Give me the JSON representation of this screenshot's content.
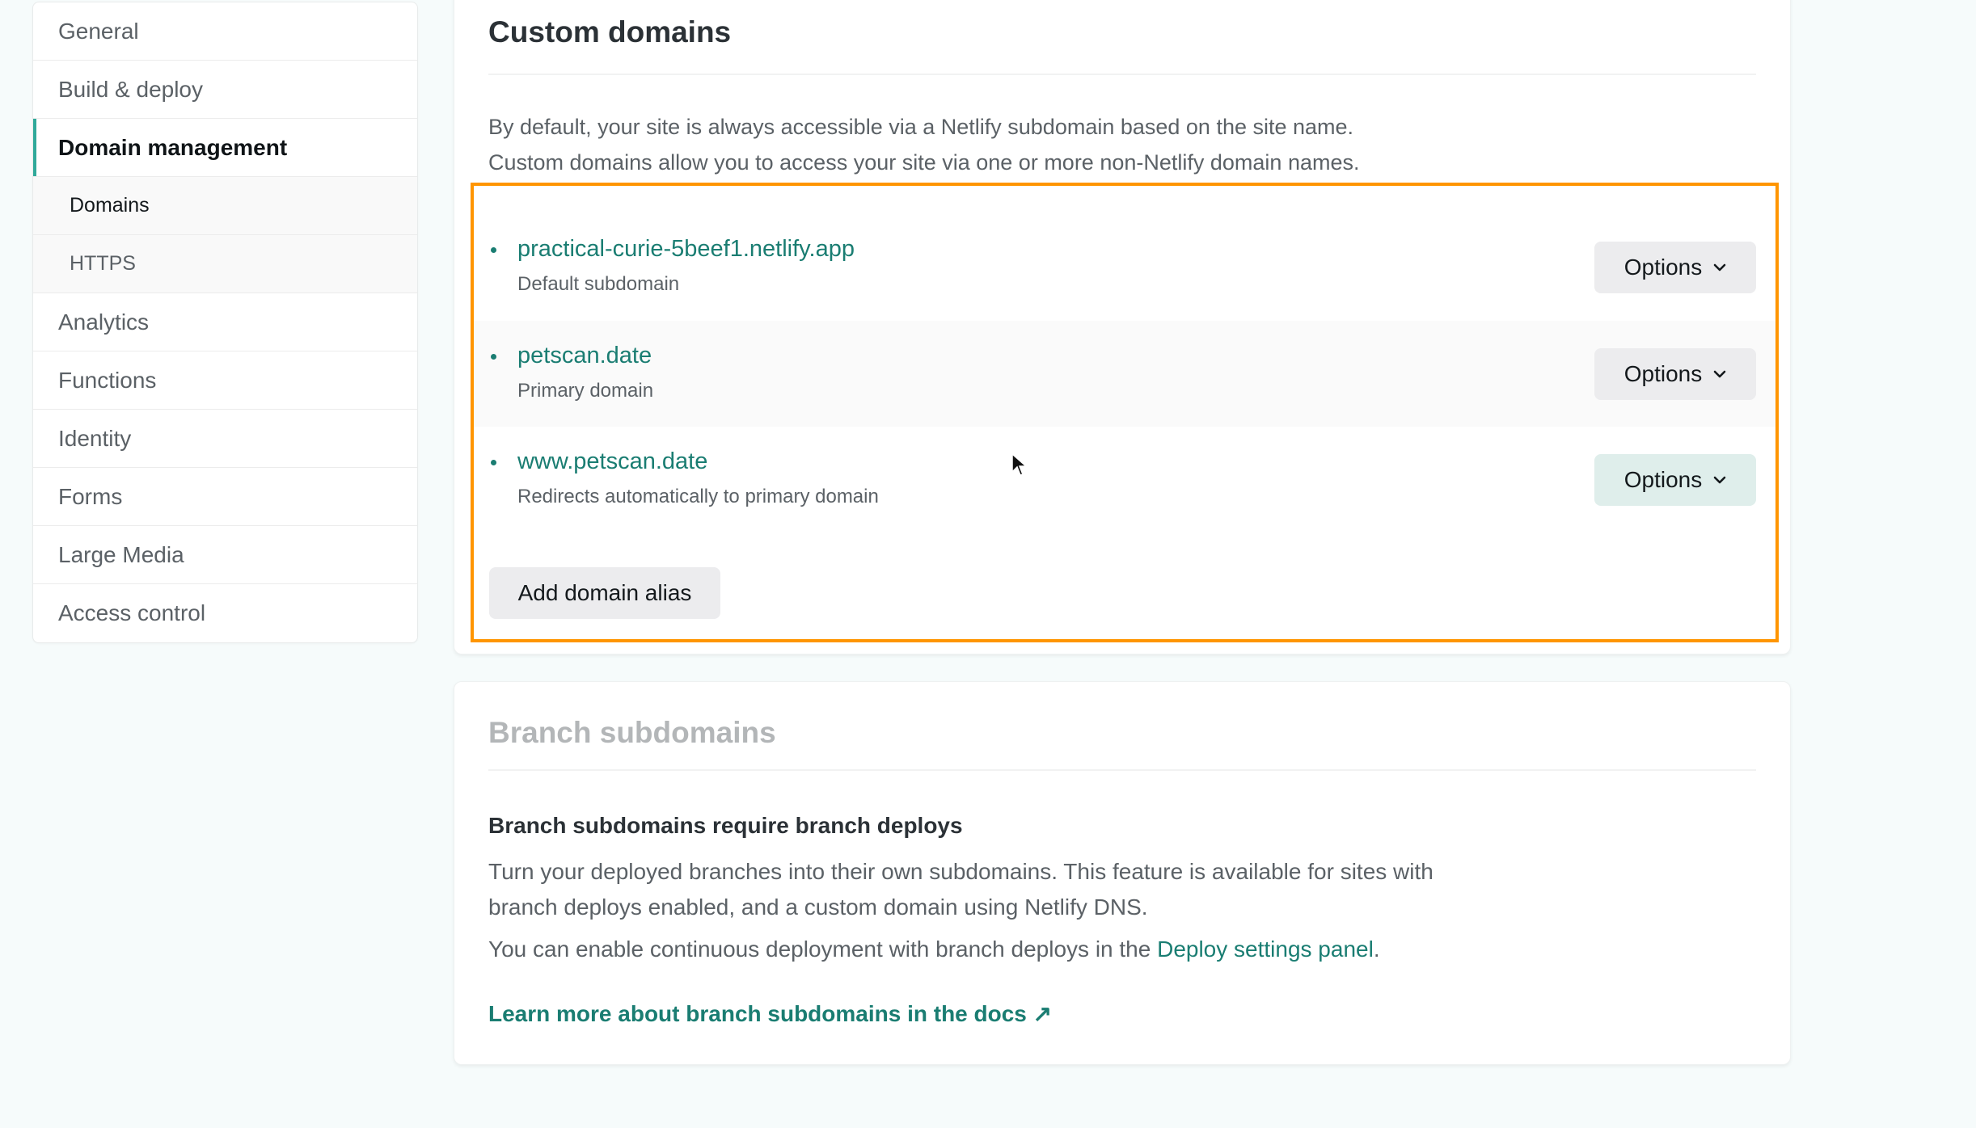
{
  "sidebar": {
    "items": [
      {
        "label": "General"
      },
      {
        "label": "Build & deploy"
      },
      {
        "label": "Domain management"
      },
      {
        "label": "Domains"
      },
      {
        "label": "HTTPS"
      },
      {
        "label": "Analytics"
      },
      {
        "label": "Functions"
      },
      {
        "label": "Identity"
      },
      {
        "label": "Forms"
      },
      {
        "label": "Large Media"
      },
      {
        "label": "Access control"
      }
    ],
    "active": "Domain management",
    "active_sub": "Domains"
  },
  "custom_domains": {
    "title": "Custom domains",
    "description_line1": "By default, your site is always accessible via a Netlify subdomain based on the site name.",
    "description_line2": "Custom domains allow you to access your site via one or more non-Netlify domain names.",
    "domains": [
      {
        "name": "practical-curie-5beef1.netlify.app",
        "subtitle": "Default subdomain",
        "options_label": "Options"
      },
      {
        "name": "petscan.date",
        "subtitle": "Primary domain",
        "options_label": "Options"
      },
      {
        "name": "www.petscan.date",
        "subtitle": "Redirects automatically to primary domain",
        "options_label": "Options"
      }
    ],
    "add_alias_label": "Add domain alias"
  },
  "branch_subdomains": {
    "title": "Branch subdomains",
    "heading": "Branch subdomains require branch deploys",
    "paragraph1": "Turn your deployed branches into their own subdomains. This feature is available for sites with branch deploys enabled, and a custom domain using Netlify DNS.",
    "paragraph2_prefix": "You can enable continuous deployment with branch deploys in the ",
    "paragraph2_link": "Deploy settings panel",
    "paragraph2_suffix": ".",
    "docs_link": "Learn more about branch subdomains in the docs",
    "docs_link_icon": "↗"
  },
  "colors": {
    "accent_teal": "#1a7d72",
    "active_bar": "#30a99a",
    "highlight_orange": "#ff9500",
    "background": "#f6fbfb"
  },
  "icons": {
    "chevron": "⌄",
    "external": "↗"
  }
}
